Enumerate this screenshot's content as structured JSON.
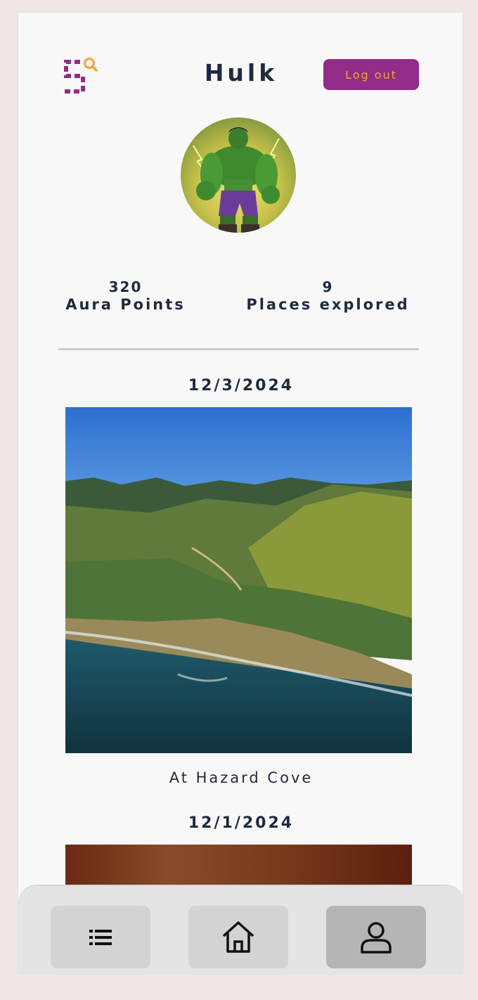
{
  "header": {
    "title": "Hulk",
    "logout_label": "Log out"
  },
  "profile": {
    "avatar_alt": "Hulk avatar"
  },
  "stats": [
    {
      "value": "320",
      "label": "Aura Points"
    },
    {
      "value": "9",
      "label": "Places explored"
    }
  ],
  "posts": [
    {
      "date": "12/3/2024",
      "caption": "At Hazard Cove"
    },
    {
      "date": "12/1/2024",
      "caption": ""
    }
  ],
  "nav": {
    "items": [
      {
        "icon": "list-icon",
        "active": false
      },
      {
        "icon": "home-icon",
        "active": false
      },
      {
        "icon": "profile-icon",
        "active": true
      }
    ]
  },
  "colors": {
    "accent": "#922c88",
    "accent_text": "#f2a33a",
    "text": "#1f2a3e",
    "background": "#f8f8f8"
  }
}
